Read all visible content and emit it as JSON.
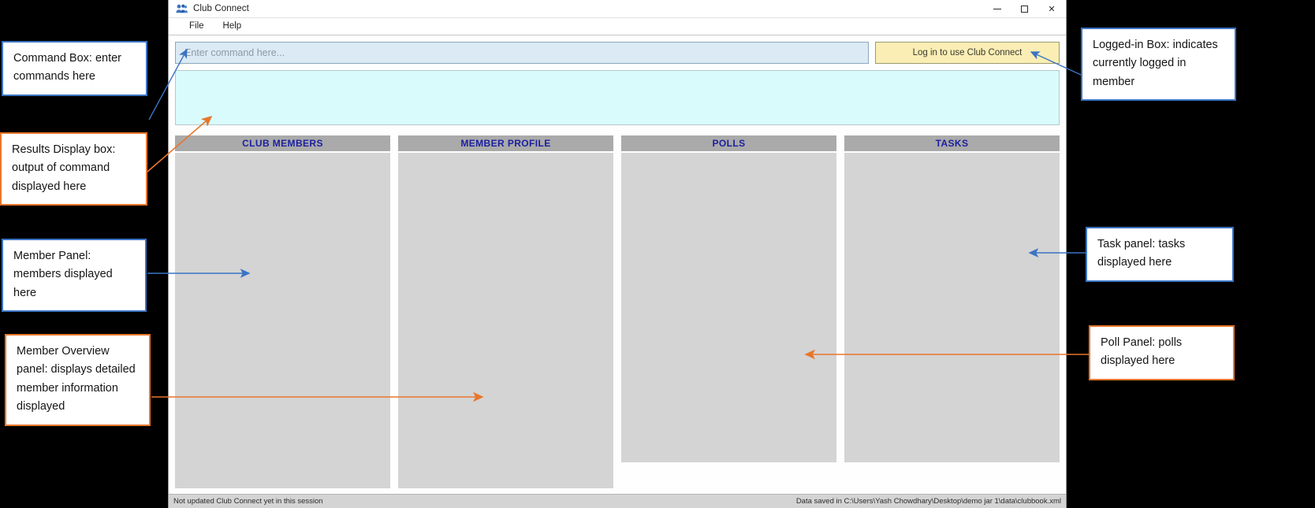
{
  "window": {
    "title": "Club Connect",
    "icon": "people-icon",
    "controls": {
      "minimize": "minimize-icon",
      "maximize": "maximize-icon",
      "close": "✕"
    }
  },
  "menubar": {
    "items": [
      {
        "label": "File"
      },
      {
        "label": "Help"
      }
    ]
  },
  "command": {
    "placeholder": "Enter command here...",
    "value": ""
  },
  "login": {
    "label": "Log in to use Club Connect",
    "background": "#faeeb4"
  },
  "results": {
    "content": "",
    "background": "#d9fbfb"
  },
  "panels": [
    {
      "title": "CLUB MEMBERS",
      "content": ""
    },
    {
      "title": "MEMBER PROFILE",
      "content": ""
    },
    {
      "title": "POLLS",
      "content": ""
    },
    {
      "title": "TASKS",
      "content": ""
    }
  ],
  "statusbar": {
    "left": "Not updated Club Connect yet in this session",
    "right": "Data saved in C:\\Users\\Yash Chowdhary\\Desktop\\demo jar 1\\data\\clubbook.xml"
  },
  "annotations": [
    {
      "id": "command",
      "text": "Command Box: enter commands here",
      "color": "#3a74c4"
    },
    {
      "id": "results",
      "text": "Results Display box: output of command displayed here",
      "color": "#e8762c"
    },
    {
      "id": "member",
      "text": "Member Panel: members displayed here",
      "color": "#3a74c4"
    },
    {
      "id": "overview",
      "text": "Member Overview panel: displays  detailed member information displayed",
      "color": "#e8762c"
    },
    {
      "id": "login",
      "text": "Logged-in Box: indicates currently logged in member",
      "color": "#3a74c4"
    },
    {
      "id": "task",
      "text": "Task panel: tasks displayed here",
      "color": "#3a74c4"
    },
    {
      "id": "poll",
      "text": "Poll Panel: polls displayed here",
      "color": "#e8762c"
    }
  ],
  "colors": {
    "accent_blue": "#3a74c4",
    "accent_orange": "#e8762c",
    "panel_header": "#aaaaaa",
    "panel_body": "#d4d4d4",
    "panel_title_text": "#1b1f9e"
  }
}
